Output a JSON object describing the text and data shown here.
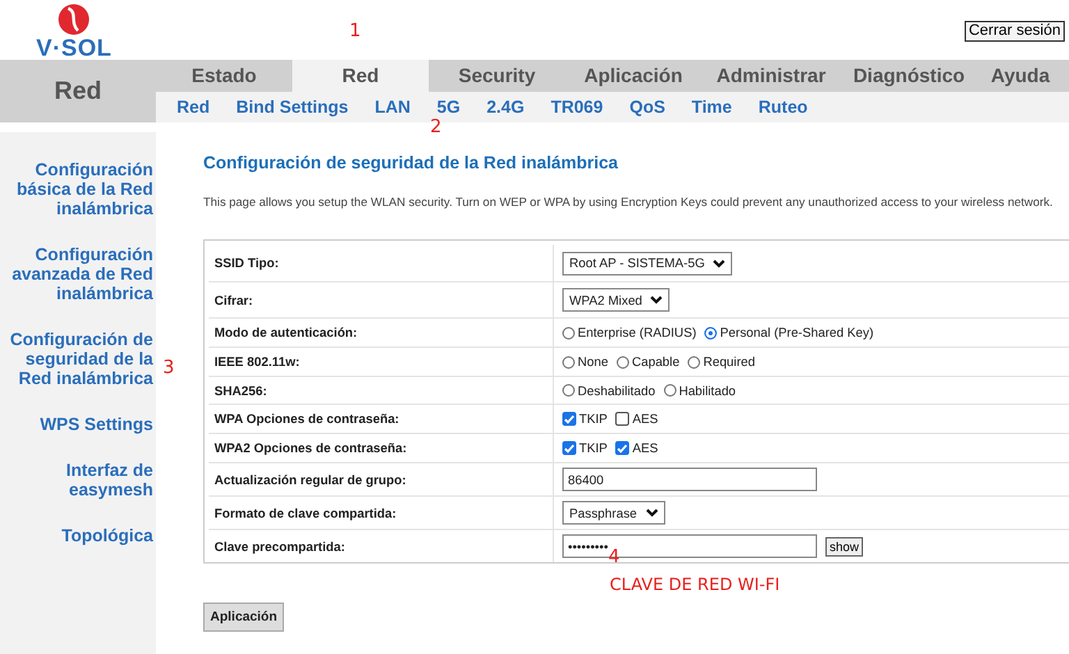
{
  "header": {
    "logo_text": "V·SOL",
    "logout_button": "Cerrar sesión"
  },
  "section_label": "Red",
  "main_tabs": [
    {
      "label": "Estado",
      "selected": false
    },
    {
      "label": "Red",
      "selected": true
    },
    {
      "label": "Security",
      "selected": false
    },
    {
      "label": "Aplicación",
      "selected": false
    },
    {
      "label": "Administrar",
      "selected": false
    },
    {
      "label": "Diagnóstico",
      "selected": false
    },
    {
      "label": "Ayuda",
      "selected": false
    }
  ],
  "sub_tabs": [
    "Red",
    "Bind Settings",
    "LAN",
    "5G",
    "2.4G",
    "TR069",
    "QoS",
    "Time",
    "Ruteo"
  ],
  "sidebar": {
    "items": [
      "Configuración básica de la Red inalámbrica",
      "Configuración avanzada de Red inalámbrica",
      "Configuración de seguridad de la Red inalámbrica",
      "WPS Settings",
      "Interfaz de easymesh",
      "Topológica"
    ]
  },
  "page": {
    "title": "Configuración de seguridad de la Red inalámbrica",
    "description": "This page allows you setup the WLAN security. Turn on WEP or WPA by using Encryption Keys could prevent any unauthorized access to your wireless network."
  },
  "form": {
    "rows": [
      {
        "label": "SSID Tipo:",
        "kind": "select",
        "value": "Root AP - SISTEMA-5G"
      },
      {
        "label": "Cifrar:",
        "kind": "select",
        "value": "WPA2 Mixed"
      },
      {
        "label": "Modo de autenticación:",
        "kind": "radio",
        "options": [
          {
            "label": "Enterprise (RADIUS)",
            "selected": false
          },
          {
            "label": "Personal (Pre-Shared Key)",
            "selected": true
          }
        ]
      },
      {
        "label": "IEEE 802.11w:",
        "kind": "radio",
        "options": [
          {
            "label": "None",
            "selected": false
          },
          {
            "label": "Capable",
            "selected": false
          },
          {
            "label": "Required",
            "selected": false
          }
        ]
      },
      {
        "label": "SHA256:",
        "kind": "radio",
        "options": [
          {
            "label": "Deshabilitado",
            "selected": false
          },
          {
            "label": "Habilitado",
            "selected": false
          }
        ]
      },
      {
        "label": "WPA Opciones de contraseña:",
        "kind": "checkbox",
        "options": [
          {
            "label": "TKIP",
            "checked": true
          },
          {
            "label": "AES",
            "checked": false
          }
        ]
      },
      {
        "label": "WPA2 Opciones de contraseña:",
        "kind": "checkbox",
        "options": [
          {
            "label": "TKIP",
            "checked": true
          },
          {
            "label": "AES",
            "checked": true
          }
        ]
      },
      {
        "label": "Actualización regular de grupo:",
        "kind": "text",
        "value": "86400"
      },
      {
        "label": "Formato de clave compartida:",
        "kind": "select",
        "value": "Passphrase"
      },
      {
        "label": "Clave precompartida:",
        "kind": "password",
        "value": "•••••••••",
        "button": "show"
      }
    ]
  },
  "apply_button": "Aplicación",
  "annotations": [
    "1",
    "2",
    "3",
    "4",
    "CLAVE DE RED WI-FI"
  ]
}
